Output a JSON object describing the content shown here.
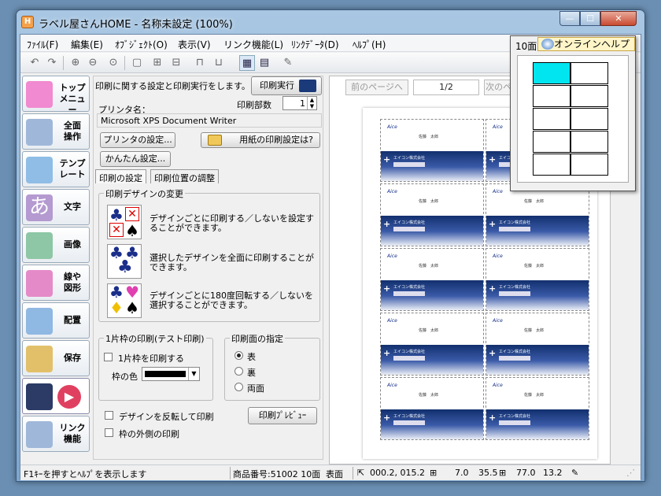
{
  "window": {
    "title": "ラベル屋さんHOME - 名称未設定 (100%)",
    "icon_letter": "H",
    "min": "—",
    "max": "☐",
    "close": "✕"
  },
  "menu": [
    "ﾌｧｲﾙ(F)",
    "編集(E)",
    "ｵﾌﾞｼﾞｪｸﾄ(O)",
    "表示(V)",
    "リンク機能(L)",
    "ﾘﾝｸﾃﾞｰﾀ(D)",
    "ﾍﾙﾌﾟ(H)"
  ],
  "toolbar_icons": [
    "undo-icon",
    "redo-icon",
    "zoom-in-icon",
    "zoom-out-icon",
    "zoom-fit-icon",
    "group-icon",
    "align-icon",
    "distribute-icon",
    "lock-icon",
    "unlock-icon",
    "grid-view-icon",
    "layout-icon",
    "paint-icon"
  ],
  "sidebar": [
    {
      "label": "トップ\nメニュー",
      "color": "#f18ad0"
    },
    {
      "label": "全面\n操作",
      "color": "#9fb7d9"
    },
    {
      "label": "テンプ\nレート",
      "color": "#8fbde6"
    },
    {
      "label": "文字",
      "color": "#b49ad0"
    },
    {
      "label": "画像",
      "color": "#8ec7a6"
    },
    {
      "label": "線や\n図形",
      "color": "#e58ac9"
    },
    {
      "label": "配置",
      "color": "#8fb8e2"
    },
    {
      "label": "保存",
      "color": "#e2c06a"
    },
    {
      "label": "",
      "color": "#e04060"
    },
    {
      "label": "リンク\n機能",
      "color": "#9fb7d9"
    }
  ],
  "panel": {
    "description": "印刷に関する設定と印刷実行をします。",
    "print_button": "印刷実行",
    "printer_label": "プリンタ名：",
    "copies_label": "印刷部数",
    "copies_value": "1",
    "printer_value": "Microsoft XPS Document Writer",
    "printer_settings_btn": "プリンタの設定...",
    "paper_help_btn": "用紙の印刷設定は?",
    "easy_settings_btn": "かんたん設定...",
    "tabs": [
      "印刷の設定",
      "印刷位置の調整"
    ],
    "design_group_title": "印刷デザインの変更",
    "design_options": [
      "デザインごとに印刷する／しないを設定することができます。",
      "選択したデザインを全面に印刷することができます。",
      "デザインごとに180度回転する／しないを選択することができます。"
    ],
    "test_group_title": "1片枠の印刷(テスト印刷)",
    "test_print_chk": "1片枠を印刷する",
    "frame_color_label": "枠の色",
    "side_group_title": "印刷面の指定",
    "side_options": [
      "表",
      "裏",
      "両面"
    ],
    "side_selected": 0,
    "mirror_chk": "デザインを反転して印刷",
    "outer_frame_chk": "枠の外側の印刷",
    "preview_btn": "印刷ﾌﾟﾚﾋﾞｭｰ"
  },
  "preview": {
    "prev_btn": "前のページへ",
    "page": "1/2",
    "next_btn": "次のページへ",
    "card_logo": "Aice",
    "card_name": "佐藤　太郎",
    "card_company": "エイコン株式会社"
  },
  "mini": {
    "label": "10面",
    "help_btn": "オンラインヘルプ"
  },
  "status": {
    "hint": "F1ｷｰを押すとﾍﾙﾌﾟを表示します",
    "product": "商品番号:51002 10面",
    "side": "表面",
    "coords": "000.2, 015.2",
    "v1": "7.0",
    "v2": "35.5",
    "v3": "77.0",
    "v4": "13.2"
  }
}
